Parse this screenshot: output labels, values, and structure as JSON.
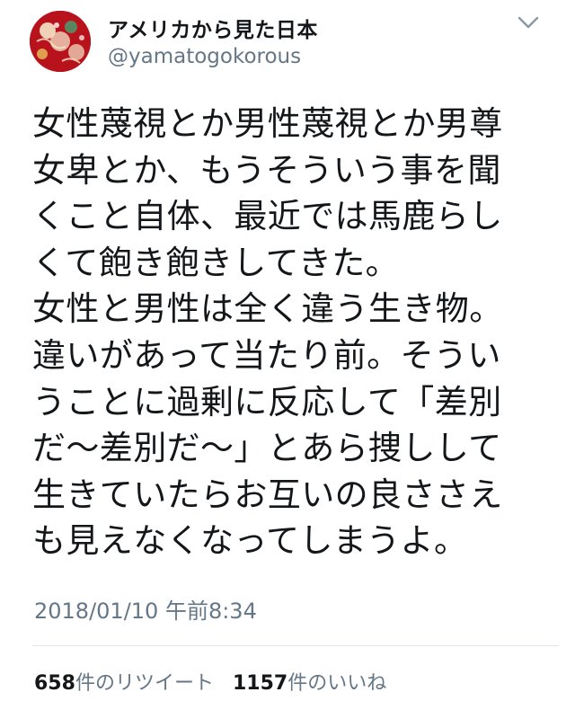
{
  "user": {
    "display_name": "アメリカから見た日本",
    "handle": "@yamatogokorous",
    "avatar_icon": "avatar-icon",
    "avatar_colors": [
      "#b8121c",
      "#f4e7c9",
      "#4a9a6a"
    ]
  },
  "menu": {
    "icon": "chevron-down-icon",
    "color": "#8899a6"
  },
  "tweet": {
    "lines": [
      "女性蔑視とか男性蔑視とか男尊",
      "女卑とか、もうそういう事を聞",
      "くこと自体、最近では馬鹿らし",
      "くて飽き飽きしてきた。",
      "女性と男性は全く違う生き物。",
      "違いがあって当たり前。そうい",
      "うことに過剰に反応して「差別",
      "だ〜差別だ〜」とあら捜しして",
      "生きていたらお互いの良ささえ",
      "も見えなくなってしまうよ。"
    ],
    "timestamp": "2018/01/10 午前8:34"
  },
  "stats": {
    "retweets_count": "658",
    "retweets_label": "件のリツイート",
    "likes_count": "1157",
    "likes_label": "件のいいね"
  }
}
